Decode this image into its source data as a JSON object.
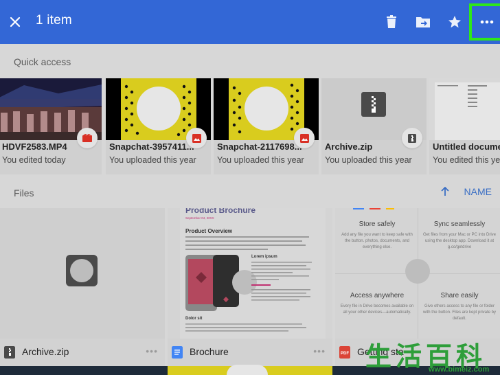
{
  "appbar": {
    "title": "1 item"
  },
  "quick_access": {
    "label": "Quick access",
    "items": [
      {
        "name": "HDVF2583.MP4",
        "subtitle": "You edited today",
        "badge": "video-icon"
      },
      {
        "name": "Snapchat-3957411...",
        "subtitle": "You uploaded this year",
        "badge": "image-icon"
      },
      {
        "name": "Snapchat-2117698...",
        "subtitle": "You uploaded this year",
        "badge": "image-icon"
      },
      {
        "name": "Archive.zip",
        "subtitle": "You uploaded this year",
        "badge": "zip-icon"
      },
      {
        "name": "Untitled docume",
        "subtitle": "You edited this year",
        "badge": "doc-icon"
      }
    ]
  },
  "files": {
    "label": "Files",
    "sort_label": "NAME",
    "items": [
      {
        "name": "Archive.zip",
        "icon": "zip-icon"
      },
      {
        "name": "Brochure",
        "icon": "doc-icon"
      },
      {
        "name": "Getting sta",
        "icon": "pdf-icon"
      }
    ]
  },
  "brochure_preview": {
    "heading": "Product Brochure",
    "date": "September 04, 20XX",
    "overview": "Product Overview",
    "lorem": "Lorem ipsum",
    "dolor": "Dolor sit"
  },
  "getting_started_preview": {
    "store": "Store safely",
    "store_text": "Add any file you want to keep safe with the button. photos, documents, and everything else.",
    "sync": "Sync seamlessly",
    "sync_text": "Get files from your Mac or PC into Drive using the desktop app. Download it at g.co/getdrive",
    "access": "Access anywhere",
    "access_text": "Every file in Drive becomes available on all your other devices—automatically.",
    "share": "Share easily",
    "share_text": "Give others access to any file or folder with the button. Files are kept private by default."
  },
  "watermark": {
    "chars": "生活百科",
    "url": "www.bimeiz.com"
  }
}
